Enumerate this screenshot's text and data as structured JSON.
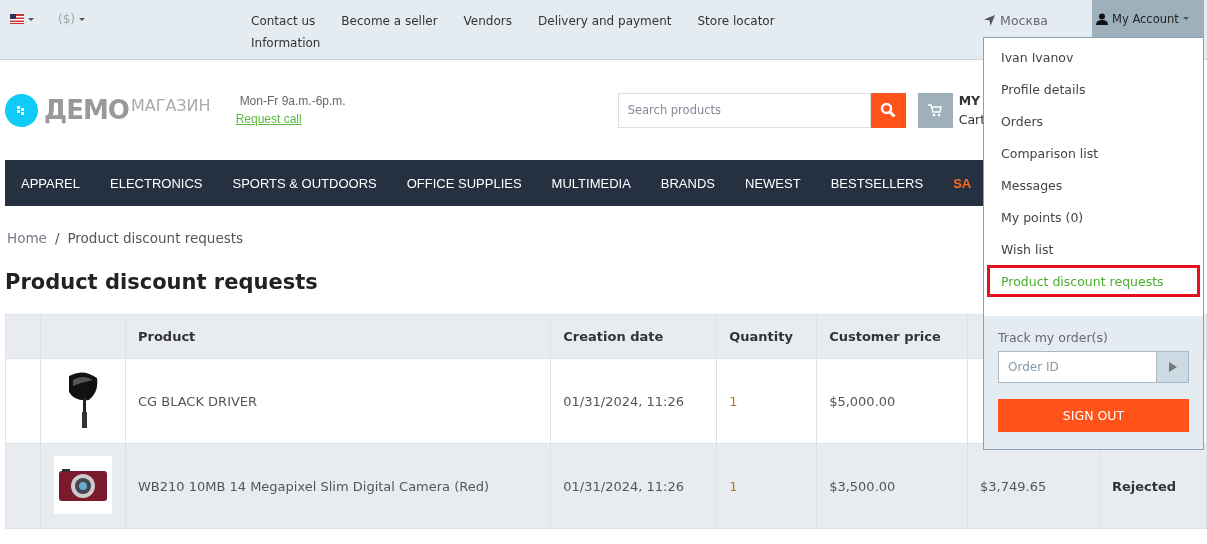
{
  "top_bar": {
    "currency": "($)",
    "links": [
      "Contact us",
      "Become a seller",
      "Vendors",
      "Delivery and payment",
      "Store locator",
      "Information"
    ],
    "location": "Москва",
    "account_button": "My Account"
  },
  "header": {
    "logo_main": "ДЕМО",
    "logo_sub": "МАГАЗИН",
    "hours": "Mon-Fr 9a.m.-6p.m.",
    "request_call": "Request call",
    "search_placeholder": "Search products",
    "cart_title": "MY",
    "cart_sub": "Cart"
  },
  "nav": [
    {
      "label": "APPAREL",
      "highlight": false
    },
    {
      "label": "ELECTRONICS",
      "highlight": false
    },
    {
      "label": "SPORTS & OUTDOORS",
      "highlight": false
    },
    {
      "label": "OFFICE SUPPLIES",
      "highlight": false
    },
    {
      "label": "MULTIMEDIA",
      "highlight": false
    },
    {
      "label": "BRANDS",
      "highlight": false
    },
    {
      "label": "NEWEST",
      "highlight": false
    },
    {
      "label": "BESTSELLERS",
      "highlight": false
    },
    {
      "label": "SA",
      "highlight": true
    }
  ],
  "breadcrumb": [
    "Home",
    "Product discount requests"
  ],
  "breadcrumb_separator": "/",
  "page_title": "Product discount requests",
  "table": {
    "columns": [
      "Product",
      "Creation date",
      "Quantity",
      "Customer price"
    ],
    "rows": [
      {
        "product": "CG BLACK DRIVER",
        "created": "01/31/2024, 11:26",
        "quantity": "1",
        "customer_price": "$5,000.00"
      },
      {
        "product": "WB210 10MB 14 Megapixel Slim Digital Camera (Red)",
        "created": "01/31/2024, 11:26",
        "quantity": "1",
        "customer_price": "$3,500.00",
        "column_7": "$3,749.65",
        "status": "Rejected"
      }
    ]
  },
  "account_menu": {
    "items": [
      {
        "label": "Ivan Ivanov",
        "selected": false
      },
      {
        "label": "Profile details",
        "selected": false
      },
      {
        "label": "Orders",
        "selected": false
      },
      {
        "label": "Comparison list",
        "selected": false
      },
      {
        "label": "Messages",
        "selected": false
      },
      {
        "label": "My points (0)",
        "selected": false
      },
      {
        "label": "Wish list",
        "selected": false
      },
      {
        "label": "Product discount requests",
        "selected": true
      }
    ],
    "track_label": "Track my order(s)",
    "order_placeholder": "Order ID",
    "sign_out": "SIGN OUT"
  }
}
